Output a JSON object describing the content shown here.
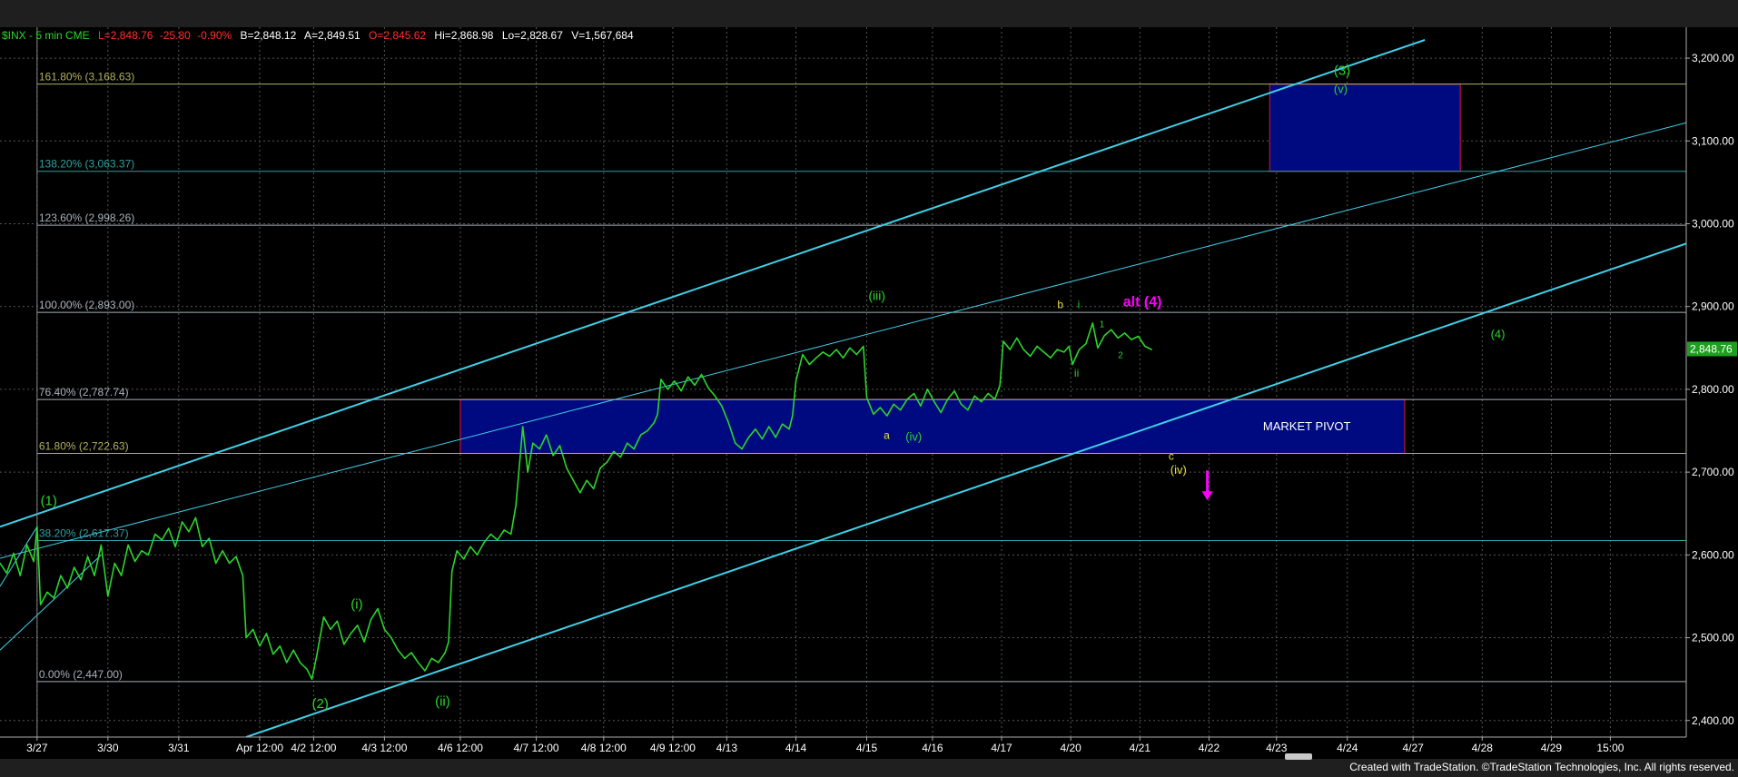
{
  "header": {
    "symbol": "$INX - 5 min  CME",
    "last": "L=2,848.76",
    "change": "-25.80",
    "pct": "-0.90%",
    "bid": "B=2,848.12",
    "ask": "A=2,849.51",
    "open": "O=2,845.62",
    "high": "Hi=2,868.98",
    "low": "Lo=2,828.67",
    "volume": "V=1,567,684"
  },
  "credit": "Created with TradeStation. ©TradeStation Technologies, Inc. All rights reserved.",
  "colors": {
    "price": "#2bd62b",
    "channel": "#3fd0e8",
    "box_fill": "#000a80",
    "box_border": "#c0103a",
    "fib_gold": "#b0b060",
    "fib_teal": "#2fa0a0",
    "fib_white": "#a8b0b8",
    "magenta": "#ff00ff",
    "yellow": "#e8e030",
    "last_tag": "#1ea01e"
  },
  "chart_data": {
    "type": "line",
    "title": "",
    "xlabel": "",
    "ylabel": "",
    "ylim": [
      2380,
      3222
    ],
    "yticks": [
      2400,
      2500,
      2600,
      2700,
      2800,
      2900,
      3000,
      3100,
      3200
    ],
    "ytick_labels": [
      "2,400.00",
      "2,500.00",
      "2,600.00",
      "2,700.00",
      "2,800.00",
      "2,900.00",
      "3,000.00",
      "3,100.00",
      "3,200.00"
    ],
    "xlim": [
      0,
      1000
    ],
    "xticks": [
      {
        "x": 22,
        "label": "3/27"
      },
      {
        "x": 64,
        "label": "3/30"
      },
      {
        "x": 106,
        "label": "3/31"
      },
      {
        "x": 154,
        "label": "Apr 12:00"
      },
      {
        "x": 186,
        "label": "4/2 12:00"
      },
      {
        "x": 228,
        "label": "4/3 12:00"
      },
      {
        "x": 273,
        "label": "4/6 12:00"
      },
      {
        "x": 318,
        "label": "4/7 12:00"
      },
      {
        "x": 358,
        "label": "4/8 12:00"
      },
      {
        "x": 399,
        "label": "4/9 12:00"
      },
      {
        "x": 431,
        "label": "4/13"
      },
      {
        "x": 472,
        "label": "4/14"
      },
      {
        "x": 514,
        "label": "4/15"
      },
      {
        "x": 553,
        "label": "4/16"
      },
      {
        "x": 594,
        "label": "4/17"
      },
      {
        "x": 635,
        "label": "4/20"
      },
      {
        "x": 676,
        "label": "4/21"
      },
      {
        "x": 717,
        "label": "4/22"
      },
      {
        "x": 757,
        "label": "4/23"
      },
      {
        "x": 799,
        "label": "4/24"
      },
      {
        "x": 838,
        "label": "4/27"
      },
      {
        "x": 879,
        "label": "4/28"
      },
      {
        "x": 920,
        "label": "4/29"
      },
      {
        "x": 955,
        "label": "15:00"
      }
    ],
    "last_price": 2848.76,
    "last_price_label": "2,848.76",
    "series": [
      {
        "values": [
          [
            0,
            2590
          ],
          [
            4,
            2578
          ],
          [
            8,
            2602
          ],
          [
            12,
            2575
          ],
          [
            16,
            2612
          ],
          [
            20,
            2592
          ],
          [
            22,
            2634
          ],
          [
            24,
            2540
          ],
          [
            28,
            2555
          ],
          [
            32,
            2548
          ],
          [
            36,
            2575
          ],
          [
            40,
            2560
          ],
          [
            44,
            2585
          ],
          [
            48,
            2570
          ],
          [
            52,
            2598
          ],
          [
            56,
            2575
          ],
          [
            60,
            2612
          ],
          [
            64,
            2550
          ],
          [
            68,
            2590
          ],
          [
            72,
            2575
          ],
          [
            76,
            2612
          ],
          [
            80,
            2592
          ],
          [
            84,
            2605
          ],
          [
            88,
            2600
          ],
          [
            92,
            2625
          ],
          [
            96,
            2618
          ],
          [
            100,
            2632
          ],
          [
            104,
            2610
          ],
          [
            108,
            2640
          ],
          [
            112,
            2628
          ],
          [
            116,
            2645
          ],
          [
            120,
            2610
          ],
          [
            124,
            2620
          ],
          [
            128,
            2590
          ],
          [
            132,
            2605
          ],
          [
            136,
            2590
          ],
          [
            140,
            2598
          ],
          [
            144,
            2575
          ],
          [
            146,
            2500
          ],
          [
            150,
            2510
          ],
          [
            154,
            2490
          ],
          [
            158,
            2505
          ],
          [
            162,
            2480
          ],
          [
            166,
            2490
          ],
          [
            170,
            2470
          ],
          [
            174,
            2485
          ],
          [
            178,
            2470
          ],
          [
            182,
            2462
          ],
          [
            185,
            2450
          ],
          [
            188,
            2480
          ],
          [
            192,
            2525
          ],
          [
            196,
            2510
          ],
          [
            200,
            2520
          ],
          [
            204,
            2492
          ],
          [
            208,
            2505
          ],
          [
            212,
            2515
          ],
          [
            216,
            2495
          ],
          [
            220,
            2522
          ],
          [
            224,
            2535
          ],
          [
            228,
            2510
          ],
          [
            232,
            2500
          ],
          [
            236,
            2485
          ],
          [
            240,
            2475
          ],
          [
            244,
            2482
          ],
          [
            248,
            2470
          ],
          [
            252,
            2460
          ],
          [
            256,
            2475
          ],
          [
            260,
            2470
          ],
          [
            264,
            2482
          ],
          [
            266,
            2495
          ],
          [
            268,
            2580
          ],
          [
            271,
            2605
          ],
          [
            275,
            2595
          ],
          [
            279,
            2610
          ],
          [
            283,
            2600
          ],
          [
            287,
            2615
          ],
          [
            291,
            2625
          ],
          [
            295,
            2618
          ],
          [
            299,
            2630
          ],
          [
            303,
            2625
          ],
          [
            306,
            2660
          ],
          [
            310,
            2755
          ],
          [
            313,
            2700
          ],
          [
            316,
            2735
          ],
          [
            320,
            2728
          ],
          [
            324,
            2745
          ],
          [
            328,
            2720
          ],
          [
            332,
            2732
          ],
          [
            336,
            2705
          ],
          [
            340,
            2690
          ],
          [
            344,
            2675
          ],
          [
            348,
            2690
          ],
          [
            352,
            2680
          ],
          [
            356,
            2705
          ],
          [
            360,
            2712
          ],
          [
            364,
            2725
          ],
          [
            368,
            2718
          ],
          [
            372,
            2735
          ],
          [
            376,
            2728
          ],
          [
            380,
            2745
          ],
          [
            384,
            2750
          ],
          [
            388,
            2760
          ],
          [
            390,
            2770
          ],
          [
            392,
            2812
          ],
          [
            396,
            2800
          ],
          [
            400,
            2810
          ],
          [
            404,
            2798
          ],
          [
            408,
            2815
          ],
          [
            412,
            2805
          ],
          [
            416,
            2818
          ],
          [
            420,
            2802
          ],
          [
            424,
            2792
          ],
          [
            428,
            2780
          ],
          [
            432,
            2760
          ],
          [
            436,
            2735
          ],
          [
            440,
            2728
          ],
          [
            444,
            2742
          ],
          [
            448,
            2752
          ],
          [
            452,
            2740
          ],
          [
            456,
            2755
          ],
          [
            460,
            2742
          ],
          [
            464,
            2758
          ],
          [
            468,
            2752
          ],
          [
            470,
            2768
          ],
          [
            472,
            2810
          ],
          [
            476,
            2842
          ],
          [
            480,
            2830
          ],
          [
            484,
            2838
          ],
          [
            488,
            2845
          ],
          [
            492,
            2840
          ],
          [
            496,
            2848
          ],
          [
            500,
            2838
          ],
          [
            504,
            2850
          ],
          [
            508,
            2842
          ],
          [
            512,
            2852
          ],
          [
            514,
            2790
          ],
          [
            518,
            2770
          ],
          [
            522,
            2778
          ],
          [
            526,
            2768
          ],
          [
            530,
            2782
          ],
          [
            534,
            2775
          ],
          [
            538,
            2788
          ],
          [
            542,
            2795
          ],
          [
            546,
            2780
          ],
          [
            550,
            2800
          ],
          [
            554,
            2785
          ],
          [
            558,
            2772
          ],
          [
            562,
            2788
          ],
          [
            566,
            2798
          ],
          [
            570,
            2782
          ],
          [
            574,
            2775
          ],
          [
            578,
            2792
          ],
          [
            582,
            2785
          ],
          [
            586,
            2795
          ],
          [
            590,
            2788
          ],
          [
            593,
            2805
          ],
          [
            595,
            2858
          ],
          [
            599,
            2848
          ],
          [
            603,
            2862
          ],
          [
            607,
            2848
          ],
          [
            611,
            2840
          ],
          [
            615,
            2852
          ],
          [
            619,
            2845
          ],
          [
            623,
            2838
          ],
          [
            627,
            2848
          ],
          [
            631,
            2845
          ],
          [
            634,
            2852
          ],
          [
            636,
            2830
          ],
          [
            640,
            2848
          ],
          [
            644,
            2855
          ],
          [
            648,
            2880
          ],
          [
            651,
            2850
          ],
          [
            655,
            2865
          ],
          [
            659,
            2872
          ],
          [
            663,
            2862
          ],
          [
            667,
            2868
          ],
          [
            671,
            2860
          ],
          [
            675,
            2864
          ],
          [
            679,
            2852
          ],
          [
            683,
            2848
          ]
        ]
      }
    ],
    "fib_levels": [
      {
        "label": "161.80% (3,168.63)",
        "value": 3168.63,
        "color": "gold"
      },
      {
        "label": "138.20% (3,063.37)",
        "value": 3063.37,
        "color": "teal"
      },
      {
        "label": "123.60% (2,998.26)",
        "value": 2998.26,
        "color": "white"
      },
      {
        "label": "100.00% (2,893.00)",
        "value": 2893.0,
        "color": "white"
      },
      {
        "label": "76.40% (2,787.74)",
        "value": 2787.74,
        "color": "white"
      },
      {
        "label": "61.80% (2,722.63)",
        "value": 2722.63,
        "color": "gold"
      },
      {
        "label": "38.20% (2,617.37)",
        "value": 2617.37,
        "color": "teal"
      },
      {
        "label": "0.00% (2,447.00)",
        "value": 2447.0,
        "color": "white"
      }
    ],
    "boxes": [
      {
        "name": "market-pivot-box",
        "x1": 273,
        "x2": 833,
        "y1": 2722.63,
        "y2": 2787.74,
        "label": "MARKET PIVOT",
        "label_x": 775,
        "label_y": 2755
      },
      {
        "name": "target-box",
        "x1": 753,
        "x2": 866,
        "y1": 3063.37,
        "y2": 3168.63
      }
    ],
    "trendlines": [
      {
        "name": "channel-upper",
        "p1": [
          0,
          2634
        ],
        "p2": [
          845,
          3222
        ],
        "color": "channel",
        "width": 2
      },
      {
        "name": "channel-lower",
        "p1": [
          146,
          2380
        ],
        "p2": [
          1000,
          2976
        ],
        "color": "channel",
        "width": 2
      },
      {
        "name": "channel-mid",
        "p1": [
          0,
          2596
        ],
        "p2": [
          1000,
          3122
        ],
        "color": "channel",
        "width": 1
      },
      {
        "name": "wave-1-stub",
        "p1": [
          0,
          2562
        ],
        "p2": [
          22,
          2634
        ],
        "color": "channel",
        "width": 1
      },
      {
        "name": "wave-1-stub-2",
        "p1": [
          0,
          2485
        ],
        "p2": [
          60,
          2600
        ],
        "color": "channel",
        "width": 1
      }
    ],
    "annotations": [
      {
        "text": "(1)",
        "x": 24,
        "y": 2660,
        "color": "green",
        "size": 15
      },
      {
        "text": "(2)",
        "x": 185,
        "y": 2415,
        "color": "green",
        "size": 15
      },
      {
        "text": "(i)",
        "x": 208,
        "y": 2535,
        "color": "green",
        "size": 15
      },
      {
        "text": "(ii)",
        "x": 258,
        "y": 2418,
        "color": "green",
        "size": 15
      },
      {
        "text": "(iii)",
        "x": 515,
        "y": 2908,
        "color": "green",
        "size": 14
      },
      {
        "text": "a",
        "x": 524,
        "y": 2740,
        "color": "yellow",
        "size": 12
      },
      {
        "text": "(iv)",
        "x": 537,
        "y": 2738,
        "color": "green",
        "size": 13
      },
      {
        "text": "b",
        "x": 627,
        "y": 2898,
        "color": "yellow",
        "size": 12
      },
      {
        "text": "i",
        "x": 639,
        "y": 2898,
        "color": "green",
        "size": 12
      },
      {
        "text": "ii",
        "x": 637,
        "y": 2815,
        "color": "green",
        "size": 12
      },
      {
        "text": "1",
        "x": 652,
        "y": 2875,
        "color": "green",
        "size": 10
      },
      {
        "text": "2",
        "x": 663,
        "y": 2838,
        "color": "green",
        "size": 10
      },
      {
        "text": "alt (4)",
        "x": 666,
        "y": 2900,
        "color": "magenta",
        "size": 16,
        "bold": true
      },
      {
        "text": "c",
        "x": 693,
        "y": 2715,
        "color": "yellow",
        "size": 12
      },
      {
        "text": "(iv)",
        "x": 694,
        "y": 2698,
        "color": "yellow",
        "size": 13
      },
      {
        "text": "(3)",
        "x": 791,
        "y": 3180,
        "color": "green",
        "size": 15
      },
      {
        "text": "(v)",
        "x": 791,
        "y": 3158,
        "color": "green",
        "size": 13
      },
      {
        "text": "(4)",
        "x": 884,
        "y": 2862,
        "color": "green",
        "size": 13
      }
    ],
    "arrow": {
      "x": 716,
      "y_top": 2702,
      "y_bottom": 2668,
      "color": "magenta"
    },
    "grid": true
  }
}
